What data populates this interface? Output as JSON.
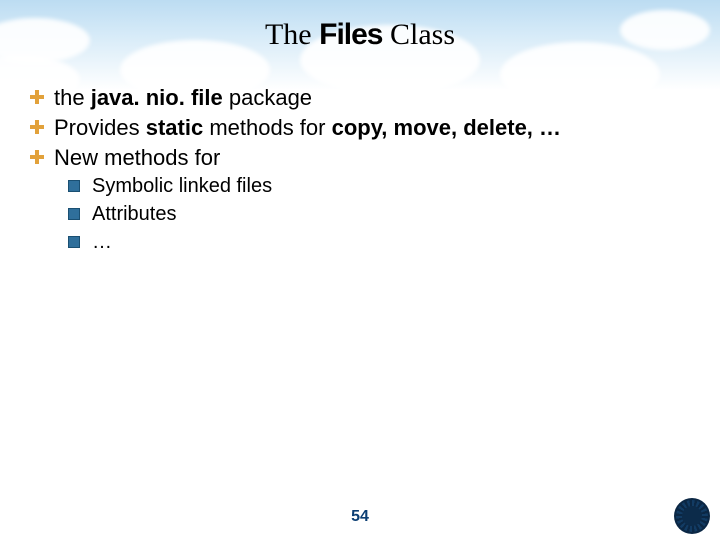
{
  "title": {
    "w1": "The",
    "w2": "Files",
    "w3": "Class"
  },
  "bullets": [
    {
      "pre": "the ",
      "bold": "java. nio. file",
      "post": " package"
    },
    {
      "pre": "Provides ",
      "bold1": "static",
      "mid": " methods for ",
      "bold2": "copy, move, delete, …"
    },
    {
      "text": "New methods for"
    }
  ],
  "sub": [
    {
      "text": "Symbolic linked files"
    },
    {
      "text": "Attributes"
    },
    {
      "text": "…"
    }
  ],
  "page_number": "54"
}
